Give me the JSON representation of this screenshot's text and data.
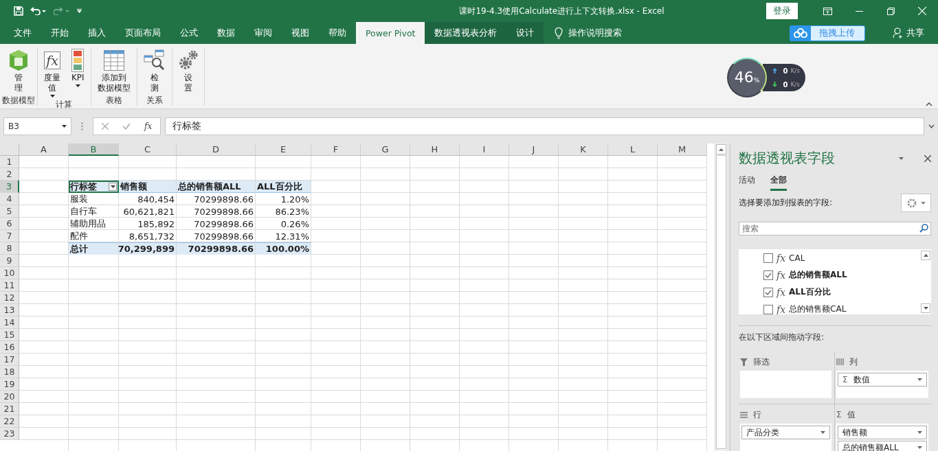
{
  "window": {
    "title": "课时19-4.3使用Calculate进行上下文转换.xlsx  -  Excel",
    "sign_in": "登录"
  },
  "tabs": [
    {
      "label": "文件",
      "selected": false,
      "contextual": false
    },
    {
      "label": "开始",
      "selected": false,
      "contextual": false
    },
    {
      "label": "插入",
      "selected": false,
      "contextual": false
    },
    {
      "label": "页面布局",
      "selected": false,
      "contextual": false
    },
    {
      "label": "公式",
      "selected": false,
      "contextual": false
    },
    {
      "label": "数据",
      "selected": false,
      "contextual": false
    },
    {
      "label": "审阅",
      "selected": false,
      "contextual": false
    },
    {
      "label": "视图",
      "selected": false,
      "contextual": false
    },
    {
      "label": "帮助",
      "selected": false,
      "contextual": false
    },
    {
      "label": "Power Pivot",
      "selected": true,
      "contextual": false
    },
    {
      "label": "数据透视表分析",
      "selected": false,
      "contextual": true
    },
    {
      "label": "设计",
      "selected": false,
      "contextual": true
    }
  ],
  "tell_me": "操作说明搜索",
  "upload_button": "拖拽上传",
  "share": "共享",
  "ribbon_groups": [
    {
      "label": "数据模型",
      "buttons": [
        {
          "kind": "model",
          "lines": [
            "管",
            "理"
          ],
          "dropdown": false
        }
      ]
    },
    {
      "label": "计算",
      "buttons": [
        {
          "kind": "measure",
          "lines": [
            "度量",
            "值"
          ],
          "dropdown": true,
          "icon_text": "fx"
        },
        {
          "kind": "kpi",
          "lines": [
            "KPI"
          ],
          "dropdown": true
        }
      ]
    },
    {
      "label": "表格",
      "buttons": [
        {
          "kind": "table",
          "lines": [
            "添加到",
            "数据模型"
          ],
          "dropdown": false
        }
      ]
    },
    {
      "label": "关系",
      "buttons": [
        {
          "kind": "detect",
          "lines": [
            "检",
            "测"
          ],
          "dropdown": false
        }
      ]
    },
    {
      "buttons": [
        {
          "kind": "settings",
          "lines": [
            "设",
            "置"
          ],
          "dropdown": false
        }
      ]
    }
  ],
  "speed_widget": {
    "percent": "46",
    "percent_sign": "%",
    "upload": "0",
    "upload_unit": "K/s",
    "download": "0",
    "download_unit": "K/s"
  },
  "formula_bar": {
    "name_box": "B3",
    "function_label": "fx",
    "value": "行标签"
  },
  "sheet": {
    "columns": [
      {
        "label": "A",
        "selected": false
      },
      {
        "label": "B",
        "selected": true
      },
      {
        "label": "C",
        "selected": false
      },
      {
        "label": "D",
        "selected": false
      },
      {
        "label": "E",
        "selected": false
      },
      {
        "label": "F",
        "selected": false
      },
      {
        "label": "G",
        "selected": false
      },
      {
        "label": "H",
        "selected": false
      },
      {
        "label": "I",
        "selected": false
      },
      {
        "label": "J",
        "selected": false
      },
      {
        "label": "K",
        "selected": false
      },
      {
        "label": "L",
        "selected": false
      },
      {
        "label": "M",
        "selected": false
      }
    ],
    "rows": [
      {
        "label": "1",
        "selected": false
      },
      {
        "label": "2",
        "selected": false
      },
      {
        "label": "3",
        "selected": true
      },
      {
        "label": "4",
        "selected": false
      },
      {
        "label": "5",
        "selected": false
      },
      {
        "label": "6",
        "selected": false
      },
      {
        "label": "7",
        "selected": false
      },
      {
        "label": "8",
        "selected": false
      },
      {
        "label": "9",
        "selected": false
      },
      {
        "label": "10",
        "selected": false
      },
      {
        "label": "11",
        "selected": false
      },
      {
        "label": "12",
        "selected": false
      },
      {
        "label": "13",
        "selected": false
      },
      {
        "label": "14",
        "selected": false
      },
      {
        "label": "15",
        "selected": false
      },
      {
        "label": "16",
        "selected": false
      },
      {
        "label": "17",
        "selected": false
      },
      {
        "label": "18",
        "selected": false
      },
      {
        "label": "19",
        "selected": false
      },
      {
        "label": "20",
        "selected": false
      },
      {
        "label": "21",
        "selected": false
      },
      {
        "label": "22",
        "selected": false
      },
      {
        "label": "23",
        "selected": false
      }
    ]
  },
  "pivot": {
    "header": [
      "行标签",
      "销售额",
      "总的销售额ALL",
      "ALL百分比"
    ],
    "rows": [
      [
        "服装",
        "840,454",
        "70299898.66",
        "1.20%"
      ],
      [
        "自行车",
        "60,621,821",
        "70299898.66",
        "86.23%"
      ],
      [
        "辅助用品",
        "185,892",
        "70299898.66",
        "0.26%"
      ],
      [
        "配件",
        "8,651,732",
        "70299898.66",
        "12.31%"
      ]
    ],
    "total": [
      "总计",
      "70,299,899",
      "70299898.66",
      "100.00%"
    ]
  },
  "pivot_pane": {
    "title": "数据透视表字段",
    "tabs": [
      {
        "label": "活动",
        "selected": false
      },
      {
        "label": "全部",
        "selected": true
      }
    ],
    "choose_label": "选择要添加到报表的字段:",
    "search": {
      "placeholder": "搜索"
    },
    "fields": [
      {
        "icon_text": "fx",
        "label": "CAL",
        "checked": false
      },
      {
        "icon_text": "fx",
        "label": "总的销售额ALL",
        "checked": true
      },
      {
        "icon_text": "fx",
        "label": "ALL百分比",
        "checked": true
      },
      {
        "icon_text": "fx",
        "label": "总的销售额CAL",
        "checked": false
      }
    ],
    "drag_label": "在以下区域间拖动字段:",
    "areas": [
      {
        "kind": "filter",
        "label": "筛选"
      },
      {
        "kind": "columns",
        "label": "列",
        "items": [
          {
            "sigma": "Σ",
            "label": "数值"
          }
        ]
      },
      {
        "kind": "rows",
        "label": "行",
        "items": [
          {
            "label": "产品分类"
          }
        ]
      },
      {
        "kind": "values",
        "label": "值",
        "icon_text": "Σ",
        "items": [
          {
            "label": "销售额"
          },
          {
            "label": "总的销售额ALL"
          }
        ]
      }
    ]
  }
}
